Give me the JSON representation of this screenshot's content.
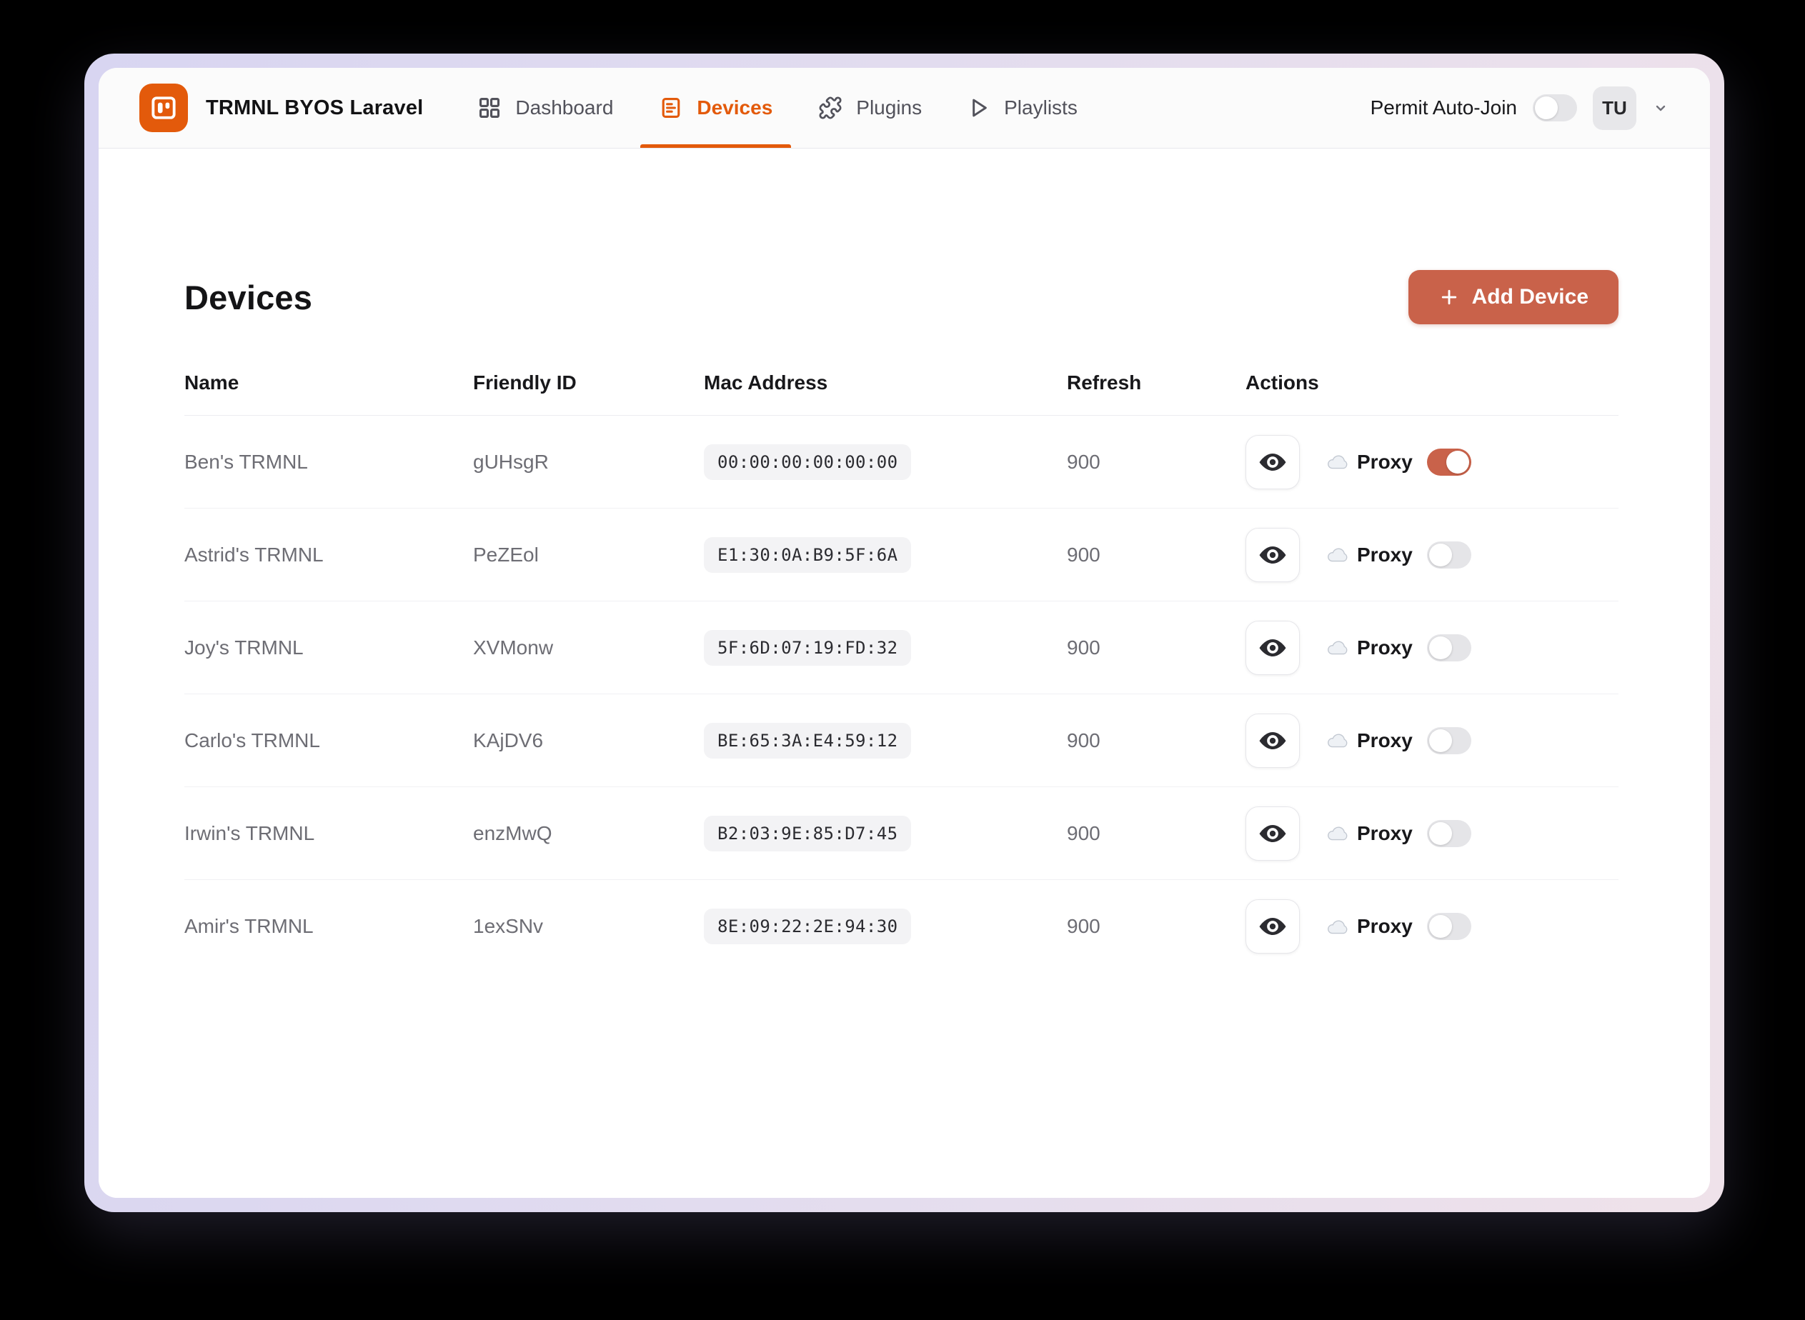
{
  "colors": {
    "brand_orange": "#e35a0b",
    "accent_terracotta": "#c9624a",
    "toggle_off": "#e5e5e8"
  },
  "header": {
    "brand": "TRMNL BYOS Laravel",
    "nav": [
      {
        "label": "Dashboard",
        "icon": "dashboard-grid-icon",
        "active": false
      },
      {
        "label": "Devices",
        "icon": "devices-icon",
        "active": true
      },
      {
        "label": "Plugins",
        "icon": "plugins-puzzle-icon",
        "active": false
      },
      {
        "label": "Playlists",
        "icon": "playlists-play-icon",
        "active": false
      }
    ],
    "permit_auto_join": {
      "label": "Permit Auto-Join",
      "enabled": false
    },
    "user": {
      "initials": "TU"
    }
  },
  "page": {
    "title": "Devices",
    "add_button": {
      "label": "Add Device"
    }
  },
  "table": {
    "columns": [
      "Name",
      "Friendly ID",
      "Mac Address",
      "Refresh",
      "Actions"
    ],
    "proxy_label": "Proxy",
    "rows": [
      {
        "name": "Ben's TRMNL",
        "friendly_id": "gUHsgR",
        "mac": "00:00:00:00:00:00",
        "refresh": "900",
        "proxy": true
      },
      {
        "name": "Astrid's TRMNL",
        "friendly_id": "PeZEol",
        "mac": "E1:30:0A:B9:5F:6A",
        "refresh": "900",
        "proxy": false
      },
      {
        "name": "Joy's TRMNL",
        "friendly_id": "XVMonw",
        "mac": "5F:6D:07:19:FD:32",
        "refresh": "900",
        "proxy": false
      },
      {
        "name": "Carlo's TRMNL",
        "friendly_id": "KAjDV6",
        "mac": "BE:65:3A:E4:59:12",
        "refresh": "900",
        "proxy": false
      },
      {
        "name": "Irwin's TRMNL",
        "friendly_id": "enzMwQ",
        "mac": "B2:03:9E:85:D7:45",
        "refresh": "900",
        "proxy": false
      },
      {
        "name": "Amir's TRMNL",
        "friendly_id": "1exSNv",
        "mac": "8E:09:22:2E:94:30",
        "refresh": "900",
        "proxy": false
      }
    ]
  }
}
